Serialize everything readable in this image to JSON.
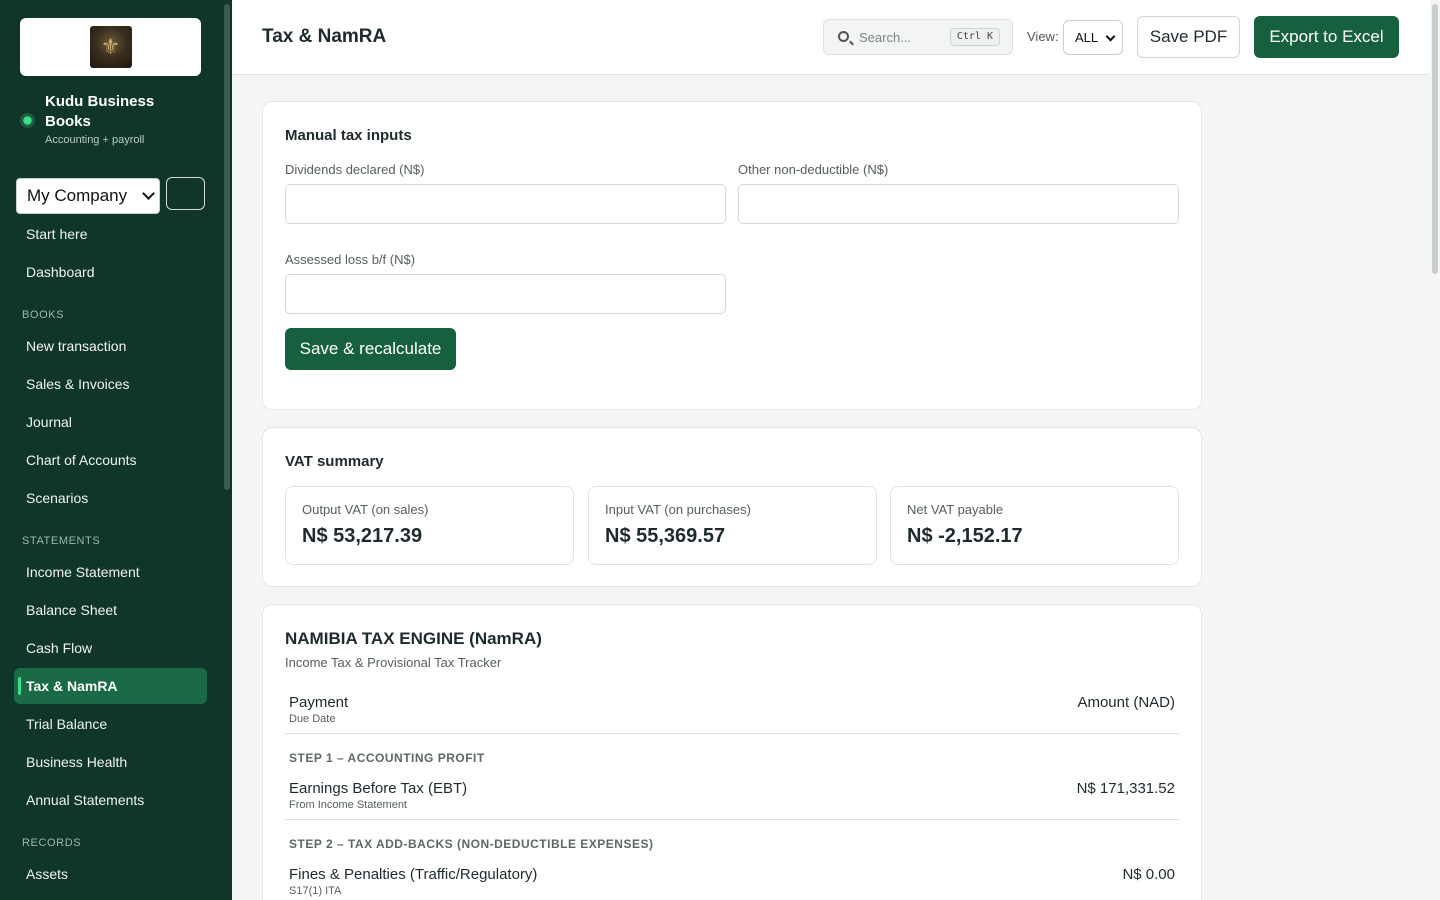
{
  "sidebar": {
    "brand_name": "Kudu Business Books",
    "brand_sub": "Accounting + payroll",
    "company": "My Company",
    "nav_top": [
      {
        "label": "Start here"
      },
      {
        "label": "Dashboard"
      }
    ],
    "section_books": "BOOKS",
    "nav_books": [
      {
        "label": "New transaction"
      },
      {
        "label": "Sales & Invoices"
      },
      {
        "label": "Journal"
      },
      {
        "label": "Chart of Accounts"
      },
      {
        "label": "Scenarios"
      }
    ],
    "section_statements": "STATEMENTS",
    "nav_statements": [
      {
        "label": "Income Statement"
      },
      {
        "label": "Balance Sheet"
      },
      {
        "label": "Cash Flow"
      },
      {
        "label": "Tax & NamRA",
        "active": true
      },
      {
        "label": "Trial Balance"
      },
      {
        "label": "Business Health"
      },
      {
        "label": "Annual Statements"
      }
    ],
    "section_records": "RECORDS",
    "nav_records": [
      {
        "label": "Assets"
      }
    ]
  },
  "header": {
    "title": "Tax & NamRA",
    "search_placeholder": "Search...",
    "search_shortcut": "Ctrl K",
    "view_label": "View:",
    "view_value": "ALL",
    "save_pdf": "Save PDF",
    "export_excel": "Export to Excel"
  },
  "manual_inputs": {
    "title": "Manual tax inputs",
    "dividends_label": "Dividends declared (N$)",
    "dividends_value": "",
    "other_label": "Other non-deductible (N$)",
    "other_value": "",
    "assessed_label": "Assessed loss b/f (N$)",
    "assessed_value": "",
    "save_button": "Save & recalculate"
  },
  "vat_summary": {
    "title": "VAT summary",
    "boxes": [
      {
        "label": "Output VAT (on sales)",
        "value": "N$ 53,217.39"
      },
      {
        "label": "Input VAT (on purchases)",
        "value": "N$ 55,369.57"
      },
      {
        "label": "Net VAT payable",
        "value": "N$ -2,152.17"
      }
    ]
  },
  "tax_engine": {
    "title": "NAMIBIA TAX ENGINE (NamRA)",
    "subtitle": "Income Tax & Provisional Tax Tracker",
    "header": {
      "col1": "Payment",
      "col1_sub": "Due Date",
      "col2": "Amount (NAD)"
    },
    "step1": "STEP 1 – ACCOUNTING PROFIT",
    "ebt": {
      "label": "Earnings Before Tax (EBT)",
      "sub": "From Income Statement",
      "amount": "N$ 171,331.52"
    },
    "step2": "STEP 2 – TAX ADD-BACKS (NON-DEDUCTIBLE EXPENSES)",
    "fines": {
      "label": "Fines & Penalties (Traffic/Regulatory)",
      "sub": "S17(1) ITA",
      "amount": "N$ 0.00"
    }
  },
  "colors": {
    "sidebar_bg": "#10362a",
    "accent_green": "#16603d",
    "active_nav": "#1a6a45"
  }
}
